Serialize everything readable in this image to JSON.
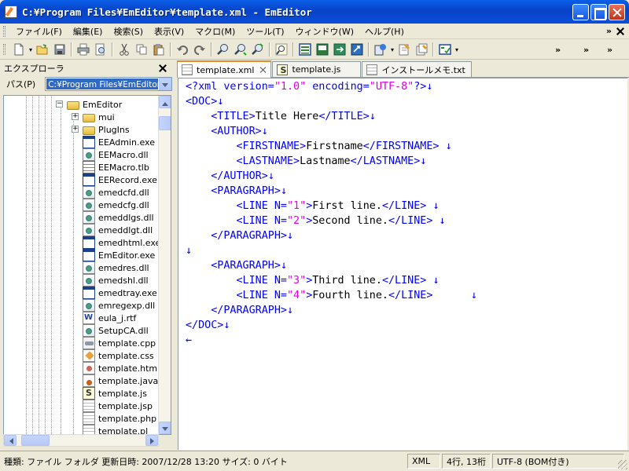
{
  "window": {
    "title": "C:¥Program Files¥EmEditor¥template.xml - EmEditor"
  },
  "menu": {
    "items": [
      "ファイル(F)",
      "編集(E)",
      "検索(S)",
      "表示(V)",
      "マクロ(M)",
      "ツール(T)",
      "ウィンドウ(W)",
      "ヘルプ(H)"
    ],
    "overflow": "»"
  },
  "toolbar": {
    "chevrons": [
      "»",
      "»",
      "»"
    ],
    "icons": [
      "new-file-icon",
      "open-file-icon",
      "save-icon",
      "print-icon",
      "print-preview-icon",
      "cut-icon",
      "copy-icon",
      "paste-icon",
      "undo-icon",
      "redo-icon",
      "find-icon",
      "find-next-icon",
      "find-prev-icon",
      "replace-icon",
      "explorer-toggle-icon",
      "outline-icon",
      "sync-icon",
      "refresh-icon",
      "plugin-icon",
      "macro-record-icon",
      "macro-run-icon",
      "configuration-icon"
    ]
  },
  "explorer": {
    "title": "エクスプローラ",
    "path_label": "パス(P)",
    "path_value": "C:¥Program Files¥EmEditor",
    "tree": [
      {
        "label": "EmEditor",
        "type": "folder",
        "level": 0,
        "expander": "−"
      },
      {
        "label": "mui",
        "type": "folder",
        "level": 1,
        "expander": "+"
      },
      {
        "label": "PlugIns",
        "type": "folder",
        "level": 1,
        "expander": "+"
      },
      {
        "label": "EEAdmin.exe",
        "type": "exe",
        "level": 1
      },
      {
        "label": "EEMacro.dll",
        "type": "dll",
        "level": 1
      },
      {
        "label": "EEMacro.tlb",
        "type": "tlb",
        "level": 1
      },
      {
        "label": "EERecord.exe",
        "type": "exe",
        "level": 1
      },
      {
        "label": "emedcfd.dll",
        "type": "dll",
        "level": 1
      },
      {
        "label": "emedcfg.dll",
        "type": "dll",
        "level": 1
      },
      {
        "label": "emeddlgs.dll",
        "type": "dll",
        "level": 1
      },
      {
        "label": "emeddlgt.dll",
        "type": "dll",
        "level": 1
      },
      {
        "label": "emedhtml.exe",
        "type": "exe",
        "level": 1
      },
      {
        "label": "EmEditor.exe",
        "type": "exe",
        "level": 1
      },
      {
        "label": "emedres.dll",
        "type": "dll",
        "level": 1
      },
      {
        "label": "emedshl.dll",
        "type": "dll",
        "level": 1
      },
      {
        "label": "emedtray.exe",
        "type": "exe",
        "level": 1
      },
      {
        "label": "emregexp.dll",
        "type": "dll",
        "level": 1
      },
      {
        "label": "eula_j.rtf",
        "type": "doc",
        "level": 1
      },
      {
        "label": "SetupCA.dll",
        "type": "dll",
        "level": 1
      },
      {
        "label": "template.cpp",
        "type": "cpp",
        "level": 1
      },
      {
        "label": "template.css",
        "type": "css",
        "level": 1
      },
      {
        "label": "template.htm",
        "type": "web",
        "level": 1
      },
      {
        "label": "template.java",
        "type": "java",
        "level": 1
      },
      {
        "label": "template.js",
        "type": "js",
        "level": 1
      },
      {
        "label": "template.jsp",
        "type": "txt",
        "level": 1
      },
      {
        "label": "template.php",
        "type": "txt",
        "level": 1
      },
      {
        "label": "template.pl",
        "type": "txt",
        "level": 1
      }
    ]
  },
  "tabs": [
    {
      "label": "template.xml",
      "active": true,
      "icon": "xml-file-icon"
    },
    {
      "label": "template.js",
      "active": false,
      "icon": "js-file-icon"
    },
    {
      "label": "インストールメモ.txt",
      "active": false,
      "icon": "text-file-icon"
    }
  ],
  "editor": {
    "lines": [
      [
        {
          "c": "mk",
          "t": "<?xml "
        },
        {
          "c": "at",
          "t": "version="
        },
        {
          "c": "av",
          "t": "\"1.0\""
        },
        {
          "c": "at",
          "t": " encoding="
        },
        {
          "c": "av",
          "t": "\"UTF-8\""
        },
        {
          "c": "mk",
          "t": "?>"
        },
        {
          "c": "mk",
          "t": "↓"
        }
      ],
      [
        {
          "c": "tg",
          "t": "<DOC>"
        },
        {
          "c": "mk",
          "t": "↓"
        }
      ],
      [
        {
          "c": "tx",
          "t": "    "
        },
        {
          "c": "tg",
          "t": "<TITLE>"
        },
        {
          "c": "tx",
          "t": "Title Here"
        },
        {
          "c": "tg",
          "t": "</TITLE>"
        },
        {
          "c": "mk",
          "t": "↓"
        }
      ],
      [
        {
          "c": "tx",
          "t": "    "
        },
        {
          "c": "tg",
          "t": "<AUTHOR>"
        },
        {
          "c": "mk",
          "t": "↓"
        }
      ],
      [
        {
          "c": "tx",
          "t": "        "
        },
        {
          "c": "tg",
          "t": "<FIRSTNAME>"
        },
        {
          "c": "tx",
          "t": "Firstname"
        },
        {
          "c": "tg",
          "t": "</FIRSTNAME>"
        },
        {
          "c": "tx",
          "t": " "
        },
        {
          "c": "mk",
          "t": "↓"
        }
      ],
      [
        {
          "c": "tx",
          "t": "        "
        },
        {
          "c": "tg",
          "t": "<LASTNAME>"
        },
        {
          "c": "tx",
          "t": "Lastname"
        },
        {
          "c": "tg",
          "t": "</LASTNAME>"
        },
        {
          "c": "mk",
          "t": "↓"
        }
      ],
      [
        {
          "c": "tx",
          "t": "    "
        },
        {
          "c": "tg",
          "t": "</AUTHOR>"
        },
        {
          "c": "mk",
          "t": "↓"
        }
      ],
      [
        {
          "c": "tx",
          "t": "    "
        },
        {
          "c": "tg",
          "t": "<PARAGRAPH>"
        },
        {
          "c": "mk",
          "t": "↓"
        }
      ],
      [
        {
          "c": "tx",
          "t": "        "
        },
        {
          "c": "tg",
          "t": "<LINE "
        },
        {
          "c": "at",
          "t": "N="
        },
        {
          "c": "av",
          "t": "\"1\""
        },
        {
          "c": "tg",
          "t": ">"
        },
        {
          "c": "tx",
          "t": "First line."
        },
        {
          "c": "tg",
          "t": "</LINE>"
        },
        {
          "c": "tx",
          "t": " "
        },
        {
          "c": "mk",
          "t": "↓"
        }
      ],
      [
        {
          "c": "tx",
          "t": "        "
        },
        {
          "c": "tg",
          "t": "<LINE "
        },
        {
          "c": "at",
          "t": "N="
        },
        {
          "c": "av",
          "t": "\"2\""
        },
        {
          "c": "tg",
          "t": ">"
        },
        {
          "c": "tx",
          "t": "Second line."
        },
        {
          "c": "tg",
          "t": "</LINE>"
        },
        {
          "c": "tx",
          "t": " "
        },
        {
          "c": "mk",
          "t": "↓"
        }
      ],
      [
        {
          "c": "tx",
          "t": "    "
        },
        {
          "c": "tg",
          "t": "</PARAGRAPH>"
        },
        {
          "c": "mk",
          "t": "↓"
        }
      ],
      [
        {
          "c": "mk",
          "t": "↓"
        }
      ],
      [
        {
          "c": "tx",
          "t": "    "
        },
        {
          "c": "tg",
          "t": "<PARAGRAPH>"
        },
        {
          "c": "mk",
          "t": "↓"
        }
      ],
      [
        {
          "c": "tx",
          "t": "        "
        },
        {
          "c": "tg",
          "t": "<LINE "
        },
        {
          "c": "at",
          "t": "N="
        },
        {
          "c": "av",
          "t": "\"3\""
        },
        {
          "c": "tg",
          "t": ">"
        },
        {
          "c": "tx",
          "t": "Third line."
        },
        {
          "c": "tg",
          "t": "</LINE>"
        },
        {
          "c": "tx",
          "t": " "
        },
        {
          "c": "mk",
          "t": "↓"
        }
      ],
      [
        {
          "c": "tx",
          "t": "        "
        },
        {
          "c": "tg",
          "t": "<LINE "
        },
        {
          "c": "at",
          "t": "N="
        },
        {
          "c": "av",
          "t": "\"4\""
        },
        {
          "c": "tg",
          "t": ">"
        },
        {
          "c": "tx",
          "t": "Fourth line."
        },
        {
          "c": "tg",
          "t": "</LINE>"
        },
        {
          "c": "tx",
          "t": "      "
        },
        {
          "c": "mk",
          "t": "↓"
        }
      ],
      [
        {
          "c": "tx",
          "t": "    "
        },
        {
          "c": "tg",
          "t": "</PARAGRAPH>"
        },
        {
          "c": "mk",
          "t": "↓"
        }
      ],
      [
        {
          "c": "tg",
          "t": "</DOC>"
        },
        {
          "c": "mk",
          "t": "↓"
        }
      ],
      [
        {
          "c": "mk",
          "t": "←"
        }
      ]
    ]
  },
  "status": {
    "info": "種類: ファイル フォルダ 更新日時: 2007/12/28 13:20 サイズ: 0 バイト",
    "mode": "XML",
    "position": "4行, 13桁",
    "encoding": "UTF-8 (BOM付き)"
  },
  "colors": {
    "tag": "#0000ff",
    "attr_value": "#e000e0",
    "text": "#000000",
    "selection": "#316ac5",
    "active_tab_accent": "#e68b2c"
  }
}
